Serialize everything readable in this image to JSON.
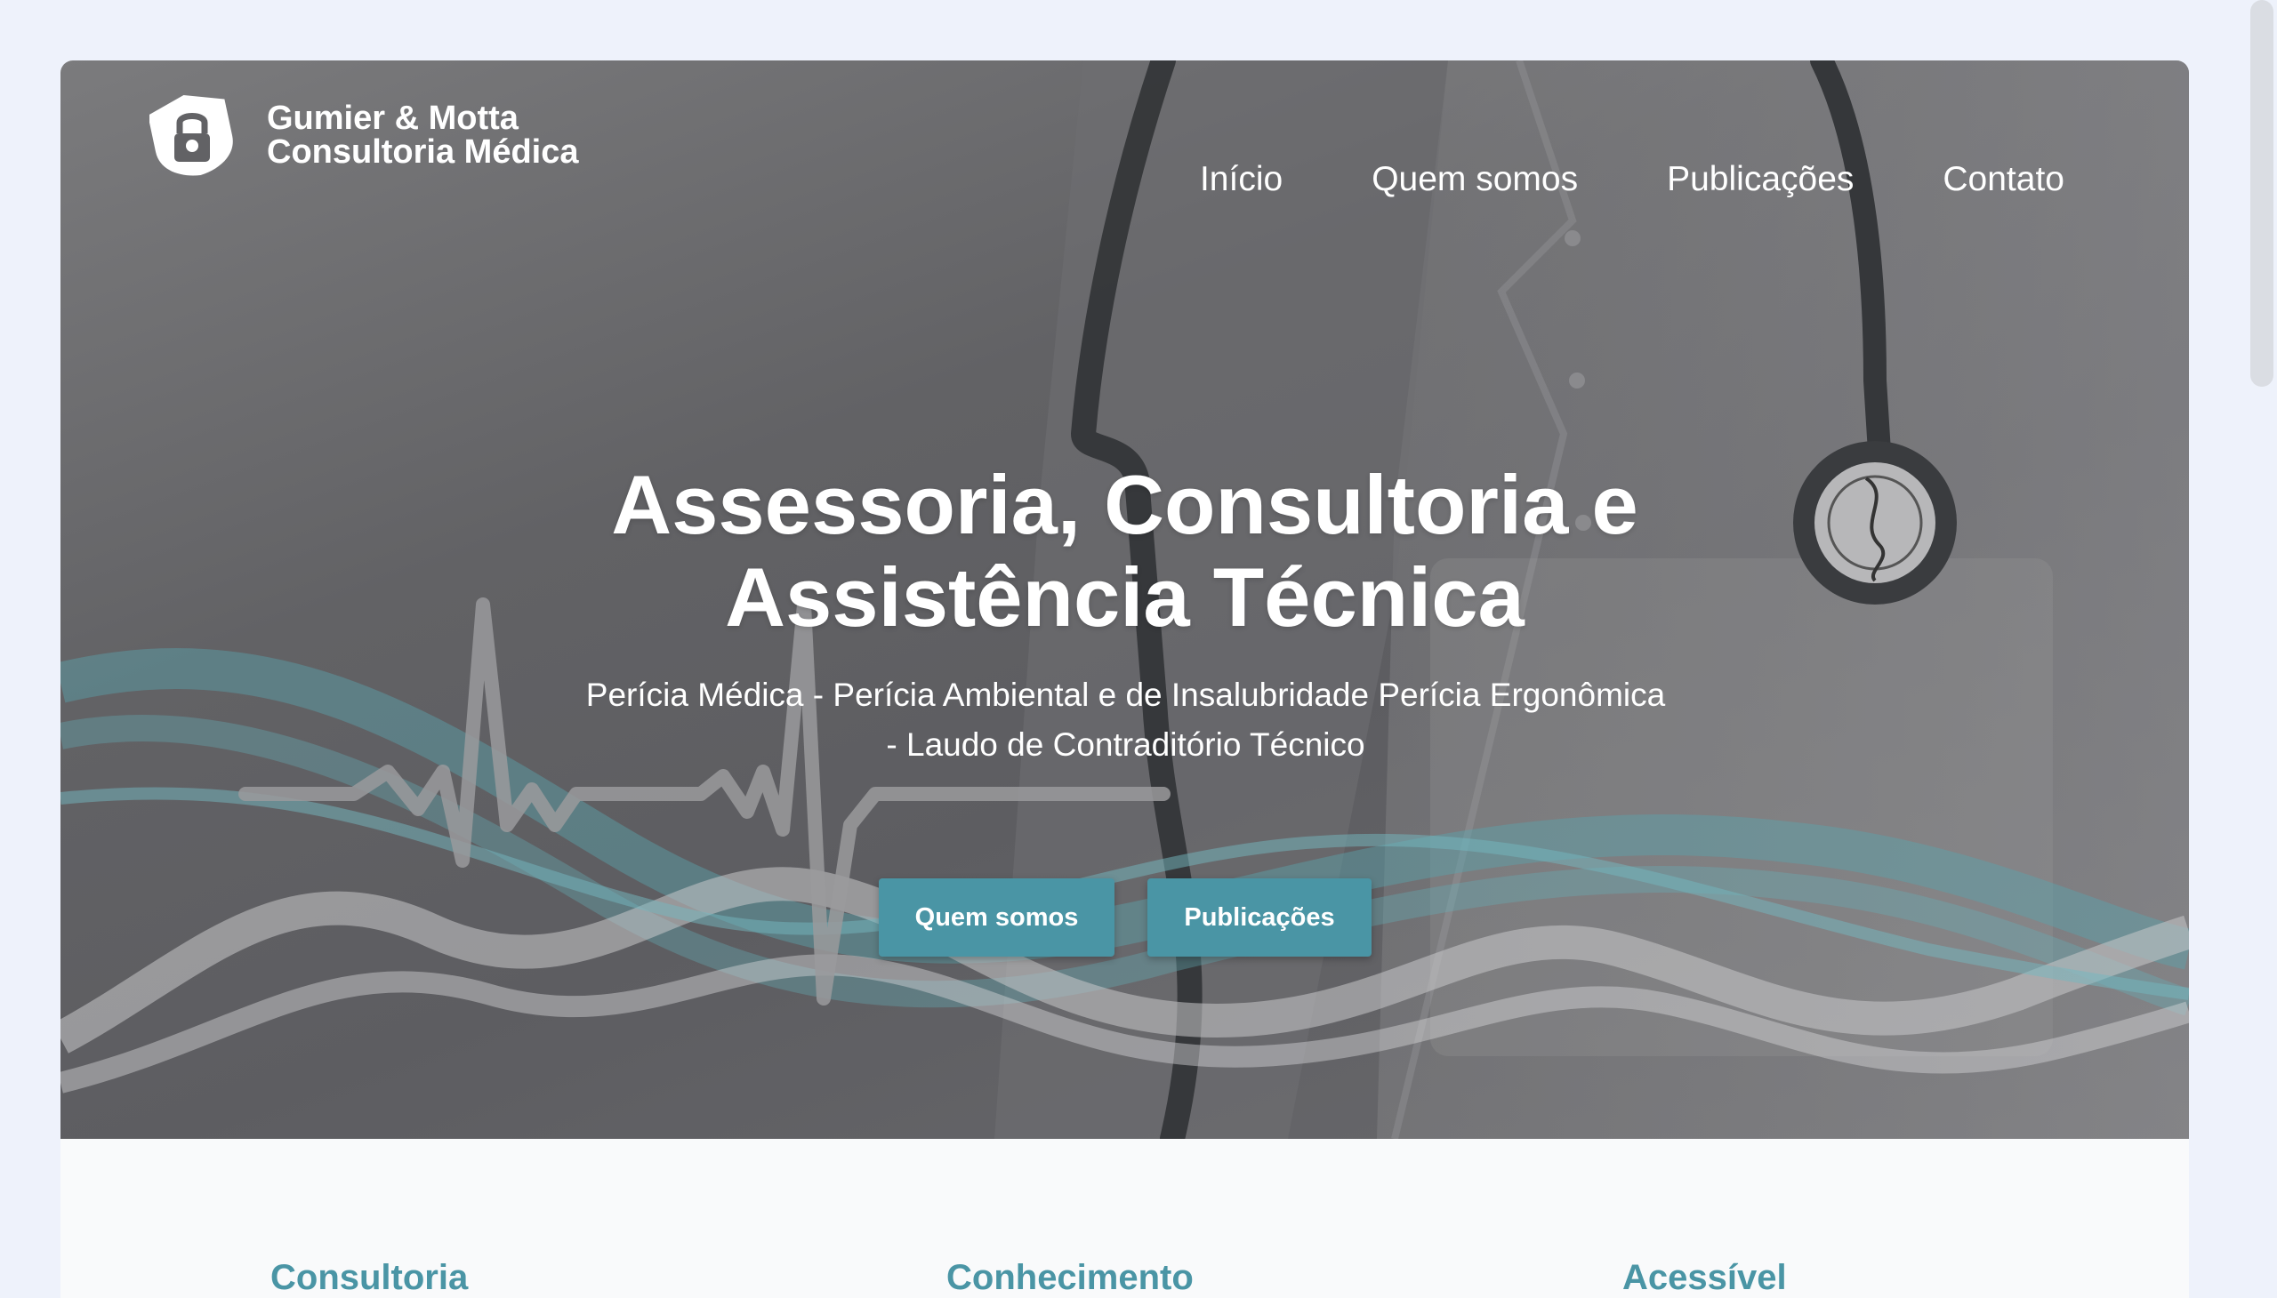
{
  "brand": {
    "line1": "Gumier & Motta",
    "line2": "Consultoria Médica",
    "logo_icon": "lock-shield-logo-icon"
  },
  "nav": {
    "items": [
      {
        "label": "Início"
      },
      {
        "label": "Quem somos"
      },
      {
        "label": "Publicações"
      },
      {
        "label": "Contato"
      }
    ]
  },
  "hero": {
    "title_line1": "Assessoria, Consultoria e",
    "title_line2": "Assistência Técnica",
    "subtitle_line1": "Perícia Médica - Perícia Ambiental e de Insalubridade Perícia Ergonômica",
    "subtitle_line2": "- Laudo de Contraditório Técnico",
    "buttons": [
      {
        "label": "Quem somos"
      },
      {
        "label": "Publicações"
      }
    ]
  },
  "features": [
    {
      "title": "Consultoria"
    },
    {
      "title": "Conhecimento"
    },
    {
      "title": "Acessível"
    }
  ],
  "colors": {
    "accent": "#4a95a5",
    "page_background": "#eef2fb",
    "hero_overlay": "#626265"
  }
}
